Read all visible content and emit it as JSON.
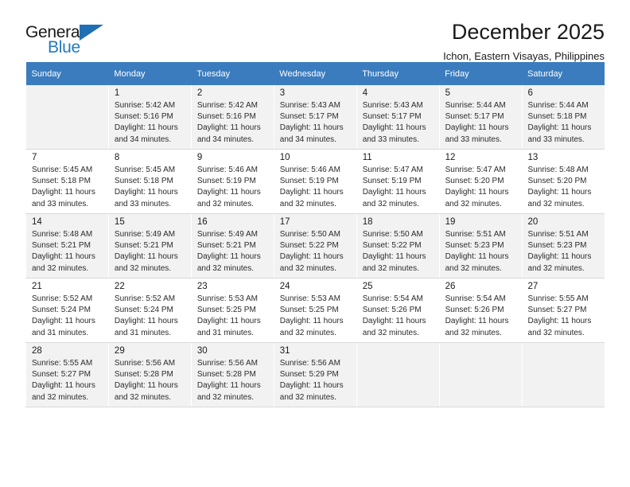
{
  "brand": {
    "name_top": "General",
    "name_bottom": "Blue",
    "flag_icon": "blue-triangle-flag-icon",
    "accent_color": "#1f7ac2"
  },
  "header": {
    "title": "December 2025",
    "subtitle": "Ichon, Eastern Visayas, Philippines"
  },
  "calendar": {
    "header_background": "#3a7cbe",
    "weekday_headers": [
      "Sunday",
      "Monday",
      "Tuesday",
      "Wednesday",
      "Thursday",
      "Friday",
      "Saturday"
    ],
    "weeks": [
      [
        {
          "day": "",
          "sunrise": "",
          "sunset": "",
          "daylight_1": "",
          "daylight_2": ""
        },
        {
          "day": "1",
          "sunrise": "Sunrise: 5:42 AM",
          "sunset": "Sunset: 5:16 PM",
          "daylight_1": "Daylight: 11 hours",
          "daylight_2": "and 34 minutes."
        },
        {
          "day": "2",
          "sunrise": "Sunrise: 5:42 AM",
          "sunset": "Sunset: 5:16 PM",
          "daylight_1": "Daylight: 11 hours",
          "daylight_2": "and 34 minutes."
        },
        {
          "day": "3",
          "sunrise": "Sunrise: 5:43 AM",
          "sunset": "Sunset: 5:17 PM",
          "daylight_1": "Daylight: 11 hours",
          "daylight_2": "and 34 minutes."
        },
        {
          "day": "4",
          "sunrise": "Sunrise: 5:43 AM",
          "sunset": "Sunset: 5:17 PM",
          "daylight_1": "Daylight: 11 hours",
          "daylight_2": "and 33 minutes."
        },
        {
          "day": "5",
          "sunrise": "Sunrise: 5:44 AM",
          "sunset": "Sunset: 5:17 PM",
          "daylight_1": "Daylight: 11 hours",
          "daylight_2": "and 33 minutes."
        },
        {
          "day": "6",
          "sunrise": "Sunrise: 5:44 AM",
          "sunset": "Sunset: 5:18 PM",
          "daylight_1": "Daylight: 11 hours",
          "daylight_2": "and 33 minutes."
        }
      ],
      [
        {
          "day": "7",
          "sunrise": "Sunrise: 5:45 AM",
          "sunset": "Sunset: 5:18 PM",
          "daylight_1": "Daylight: 11 hours",
          "daylight_2": "and 33 minutes."
        },
        {
          "day": "8",
          "sunrise": "Sunrise: 5:45 AM",
          "sunset": "Sunset: 5:18 PM",
          "daylight_1": "Daylight: 11 hours",
          "daylight_2": "and 33 minutes."
        },
        {
          "day": "9",
          "sunrise": "Sunrise: 5:46 AM",
          "sunset": "Sunset: 5:19 PM",
          "daylight_1": "Daylight: 11 hours",
          "daylight_2": "and 32 minutes."
        },
        {
          "day": "10",
          "sunrise": "Sunrise: 5:46 AM",
          "sunset": "Sunset: 5:19 PM",
          "daylight_1": "Daylight: 11 hours",
          "daylight_2": "and 32 minutes."
        },
        {
          "day": "11",
          "sunrise": "Sunrise: 5:47 AM",
          "sunset": "Sunset: 5:19 PM",
          "daylight_1": "Daylight: 11 hours",
          "daylight_2": "and 32 minutes."
        },
        {
          "day": "12",
          "sunrise": "Sunrise: 5:47 AM",
          "sunset": "Sunset: 5:20 PM",
          "daylight_1": "Daylight: 11 hours",
          "daylight_2": "and 32 minutes."
        },
        {
          "day": "13",
          "sunrise": "Sunrise: 5:48 AM",
          "sunset": "Sunset: 5:20 PM",
          "daylight_1": "Daylight: 11 hours",
          "daylight_2": "and 32 minutes."
        }
      ],
      [
        {
          "day": "14",
          "sunrise": "Sunrise: 5:48 AM",
          "sunset": "Sunset: 5:21 PM",
          "daylight_1": "Daylight: 11 hours",
          "daylight_2": "and 32 minutes."
        },
        {
          "day": "15",
          "sunrise": "Sunrise: 5:49 AM",
          "sunset": "Sunset: 5:21 PM",
          "daylight_1": "Daylight: 11 hours",
          "daylight_2": "and 32 minutes."
        },
        {
          "day": "16",
          "sunrise": "Sunrise: 5:49 AM",
          "sunset": "Sunset: 5:21 PM",
          "daylight_1": "Daylight: 11 hours",
          "daylight_2": "and 32 minutes."
        },
        {
          "day": "17",
          "sunrise": "Sunrise: 5:50 AM",
          "sunset": "Sunset: 5:22 PM",
          "daylight_1": "Daylight: 11 hours",
          "daylight_2": "and 32 minutes."
        },
        {
          "day": "18",
          "sunrise": "Sunrise: 5:50 AM",
          "sunset": "Sunset: 5:22 PM",
          "daylight_1": "Daylight: 11 hours",
          "daylight_2": "and 32 minutes."
        },
        {
          "day": "19",
          "sunrise": "Sunrise: 5:51 AM",
          "sunset": "Sunset: 5:23 PM",
          "daylight_1": "Daylight: 11 hours",
          "daylight_2": "and 32 minutes."
        },
        {
          "day": "20",
          "sunrise": "Sunrise: 5:51 AM",
          "sunset": "Sunset: 5:23 PM",
          "daylight_1": "Daylight: 11 hours",
          "daylight_2": "and 32 minutes."
        }
      ],
      [
        {
          "day": "21",
          "sunrise": "Sunrise: 5:52 AM",
          "sunset": "Sunset: 5:24 PM",
          "daylight_1": "Daylight: 11 hours",
          "daylight_2": "and 31 minutes."
        },
        {
          "day": "22",
          "sunrise": "Sunrise: 5:52 AM",
          "sunset": "Sunset: 5:24 PM",
          "daylight_1": "Daylight: 11 hours",
          "daylight_2": "and 31 minutes."
        },
        {
          "day": "23",
          "sunrise": "Sunrise: 5:53 AM",
          "sunset": "Sunset: 5:25 PM",
          "daylight_1": "Daylight: 11 hours",
          "daylight_2": "and 31 minutes."
        },
        {
          "day": "24",
          "sunrise": "Sunrise: 5:53 AM",
          "sunset": "Sunset: 5:25 PM",
          "daylight_1": "Daylight: 11 hours",
          "daylight_2": "and 32 minutes."
        },
        {
          "day": "25",
          "sunrise": "Sunrise: 5:54 AM",
          "sunset": "Sunset: 5:26 PM",
          "daylight_1": "Daylight: 11 hours",
          "daylight_2": "and 32 minutes."
        },
        {
          "day": "26",
          "sunrise": "Sunrise: 5:54 AM",
          "sunset": "Sunset: 5:26 PM",
          "daylight_1": "Daylight: 11 hours",
          "daylight_2": "and 32 minutes."
        },
        {
          "day": "27",
          "sunrise": "Sunrise: 5:55 AM",
          "sunset": "Sunset: 5:27 PM",
          "daylight_1": "Daylight: 11 hours",
          "daylight_2": "and 32 minutes."
        }
      ],
      [
        {
          "day": "28",
          "sunrise": "Sunrise: 5:55 AM",
          "sunset": "Sunset: 5:27 PM",
          "daylight_1": "Daylight: 11 hours",
          "daylight_2": "and 32 minutes."
        },
        {
          "day": "29",
          "sunrise": "Sunrise: 5:56 AM",
          "sunset": "Sunset: 5:28 PM",
          "daylight_1": "Daylight: 11 hours",
          "daylight_2": "and 32 minutes."
        },
        {
          "day": "30",
          "sunrise": "Sunrise: 5:56 AM",
          "sunset": "Sunset: 5:28 PM",
          "daylight_1": "Daylight: 11 hours",
          "daylight_2": "and 32 minutes."
        },
        {
          "day": "31",
          "sunrise": "Sunrise: 5:56 AM",
          "sunset": "Sunset: 5:29 PM",
          "daylight_1": "Daylight: 11 hours",
          "daylight_2": "and 32 minutes."
        },
        {
          "day": "",
          "sunrise": "",
          "sunset": "",
          "daylight_1": "",
          "daylight_2": ""
        },
        {
          "day": "",
          "sunrise": "",
          "sunset": "",
          "daylight_1": "",
          "daylight_2": ""
        },
        {
          "day": "",
          "sunrise": "",
          "sunset": "",
          "daylight_1": "",
          "daylight_2": ""
        }
      ]
    ]
  }
}
